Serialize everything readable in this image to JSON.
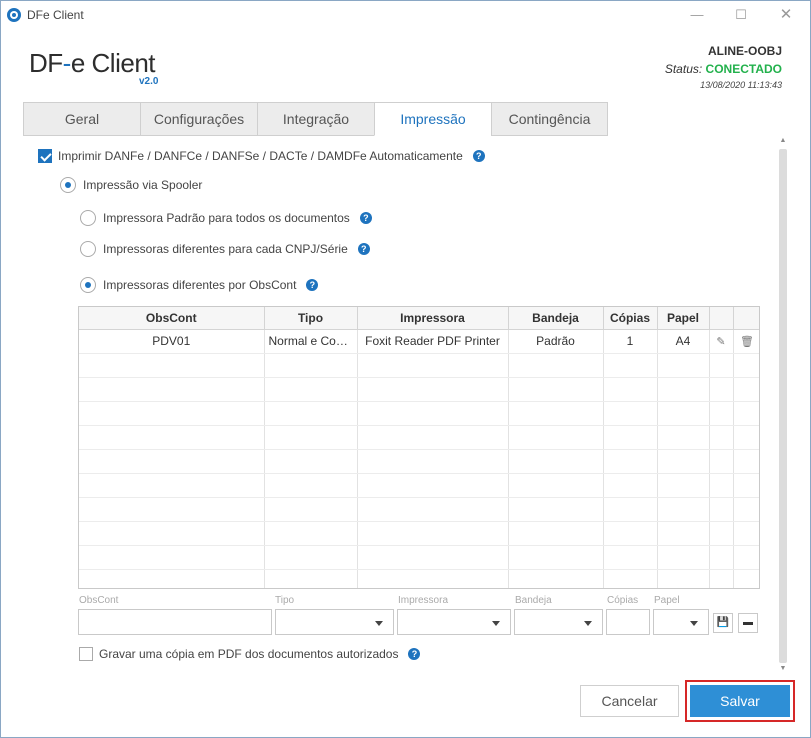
{
  "window": {
    "title": "DFe Client"
  },
  "logo": {
    "text_a": "DF",
    "text_b": "-",
    "text_c": "e Client",
    "version": "v2.0"
  },
  "header": {
    "user": "ALINE-OOBJ",
    "status_label": "Status:",
    "status_value": "CONECTADO",
    "datetime": "13/08/2020 11:13:43",
    "status_color": "#22b14c"
  },
  "tabs": [
    {
      "label": "Geral",
      "active": false
    },
    {
      "label": "Configurações",
      "active": false
    },
    {
      "label": "Integração",
      "active": false
    },
    {
      "label": "Impressão",
      "active": true
    },
    {
      "label": "Contingência",
      "active": false
    }
  ],
  "options": {
    "auto_print": {
      "label": "Imprimir DANFe / DANFCe / DANFSe / DACTe / DAMDFe Automaticamente",
      "checked": true
    },
    "spooler": {
      "label": "Impressão via Spooler",
      "selected": true
    },
    "printer_default": {
      "label": "Impressora Padrão para todos os documentos",
      "selected": false
    },
    "printer_cnpj": {
      "label": "Impressoras diferentes para cada CNPJ/Série",
      "selected": false
    },
    "printer_obscont": {
      "label": "Impressoras diferentes por ObsCont",
      "selected": true
    },
    "pdf_copy": {
      "label": "Gravar uma cópia em PDF dos documentos autorizados",
      "checked": false
    }
  },
  "table": {
    "columns": [
      "ObsCont",
      "Tipo",
      "Impressora",
      "Bandeja",
      "Cópias",
      "Papel"
    ],
    "rows": [
      {
        "obscont": "PDV01",
        "tipo": "Normal e Cont...",
        "impressora": "Foxit Reader PDF Printer",
        "bandeja": "Padrão",
        "copias": "1",
        "papel": "A4"
      }
    ]
  },
  "form": {
    "labels": {
      "obscont": "ObsCont",
      "tipo": "Tipo",
      "impressora": "Impressora",
      "bandeja": "Bandeja",
      "copias": "Cópias",
      "papel": "Papel"
    },
    "values": {
      "obscont": "",
      "tipo": "",
      "impressora": "",
      "bandeja": "",
      "copias": "",
      "papel": ""
    }
  },
  "icons": {
    "help": "question-icon",
    "edit": "edit-icon",
    "delete": "trash-icon",
    "save": "floppy-icon",
    "clear": "eraser-icon"
  },
  "buttons": {
    "cancel": "Cancelar",
    "save": "Salvar"
  },
  "colors": {
    "accent": "#1e73be",
    "save_button": "#2e8fd6",
    "highlight": "#d62828"
  }
}
